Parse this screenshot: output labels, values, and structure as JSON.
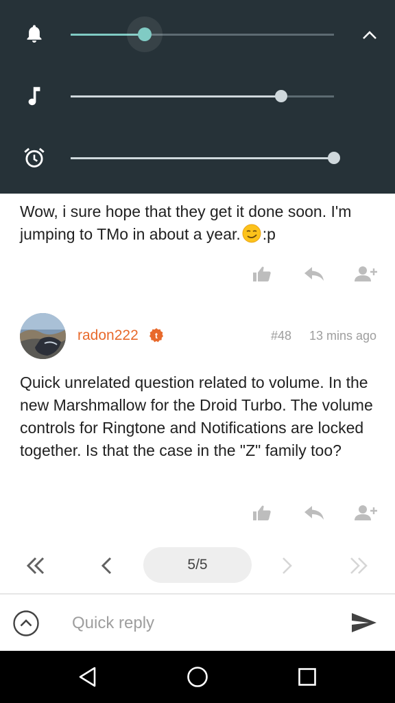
{
  "volume_panel": {
    "accent_color": "#80cbc4",
    "sliders": [
      {
        "name": "notification",
        "icon": "bell-icon",
        "level": 0.28,
        "active": true
      },
      {
        "name": "media",
        "icon": "music-note-icon",
        "level": 0.8,
        "active": false
      },
      {
        "name": "alarm",
        "icon": "alarm-clock-icon",
        "level": 1.0,
        "active": false
      }
    ],
    "collapse_icon": "chevron-up-icon"
  },
  "posts": [
    {
      "text": "Wow, i sure hope that they get it done soon. I'm jumping to TMo in about a year.",
      "emoji_icon": "smirk-emoji-icon",
      "text_suffix": ":p"
    },
    {
      "author": "radon222",
      "author_color": "#e8692b",
      "badge_label": "t",
      "post_number": "#48",
      "time_ago": "13 mins ago",
      "text": "Quick unrelated question related to volume. In the new Marshmallow for the Droid Turbo. The volume controls for Ringtone and Notifications are locked together. Is that the case in the \"Z\" family too?"
    }
  ],
  "actions": [
    "like-icon",
    "reply-icon",
    "follow-user-icon"
  ],
  "pagination": {
    "current": "5/5"
  },
  "quick_reply": {
    "placeholder": "Quick reply"
  },
  "nav": [
    "back-icon",
    "home-icon",
    "recents-icon"
  ]
}
